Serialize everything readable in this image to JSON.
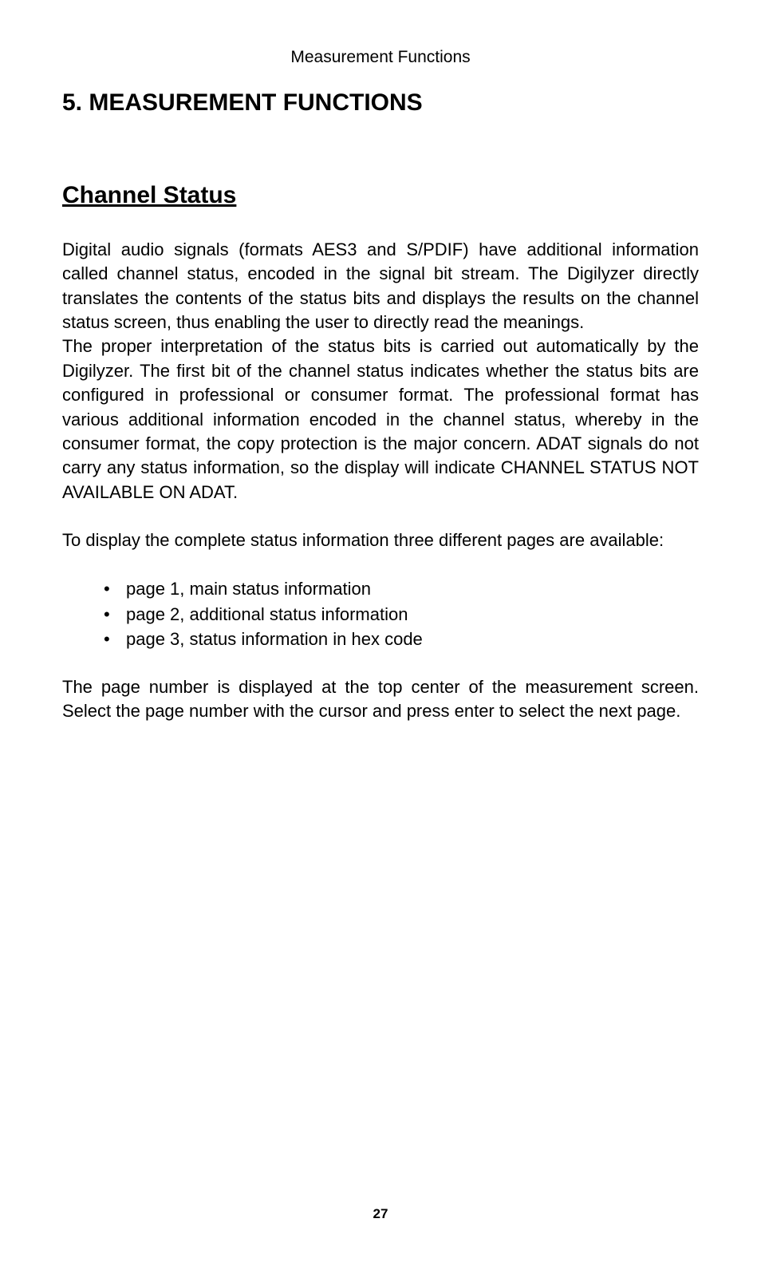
{
  "header": "Measurement Functions",
  "chapter_title": "5. MEASUREMENT FUNCTIONS",
  "section_title": "Channel Status",
  "paragraph1": "Digital audio signals (formats AES3 and S/PDIF) have additional information called channel status, encoded in the signal bit stream. The Digilyzer directly translates the contents of the status bits and displays the results on the channel status screen, thus enabling the user to directly read the meanings.",
  "paragraph2": "The proper interpretation of the status bits is carried out automatically by the Digilyzer. The first bit of the channel status indicates whether the status bits are configured in professional or consumer format. The professional format has various additional information encoded in the channel status, whereby in the consumer format, the copy protection is the major concern. ADAT signals do not carry any status information, so the display will indicate CHANNEL STATUS NOT AVAILABLE ON ADAT.",
  "paragraph3": "To display the complete status information three different pages are available:",
  "bullets": [
    "page 1, main status information",
    "page 2, additional status information",
    "page 3, status information in hex code"
  ],
  "paragraph4": "The page number is displayed at the top center of the measurement screen. Select the page number with the cursor and press enter to select the next page.",
  "page_number": "27"
}
